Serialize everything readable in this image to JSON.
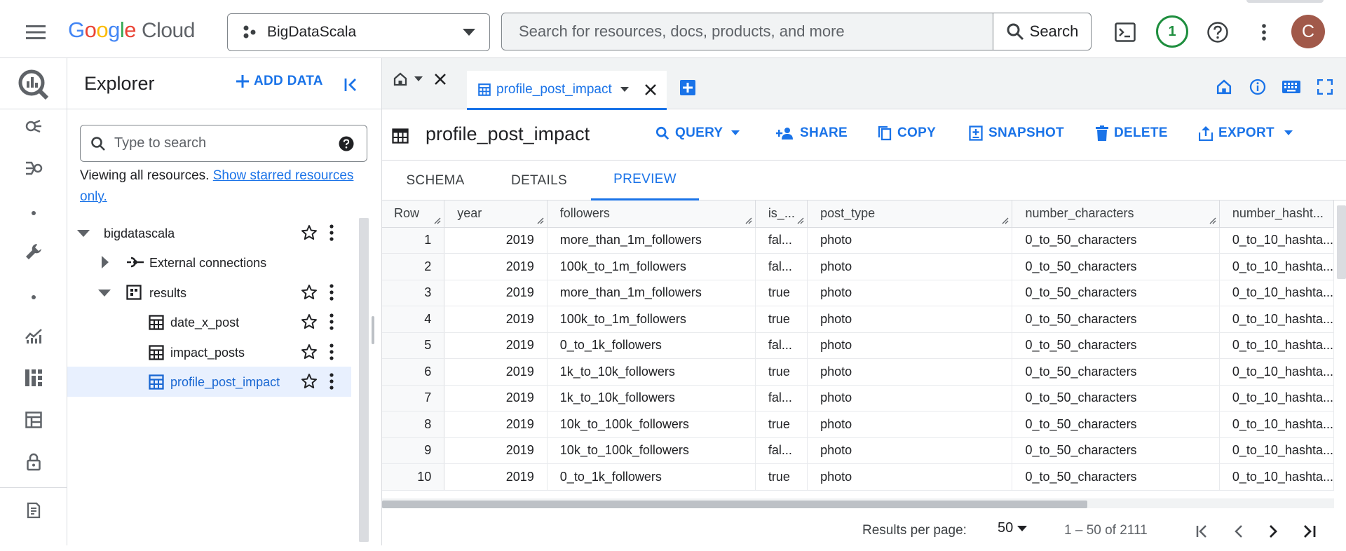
{
  "header": {
    "logo_letters": [
      "G",
      "o",
      "o",
      "g",
      "l",
      "e"
    ],
    "logo_colors": [
      "#4285F4",
      "#EA4335",
      "#FBBC05",
      "#4285F4",
      "#34A853",
      "#EA4335"
    ],
    "logo_cloud": "Cloud",
    "project": "BigDataScala",
    "search_placeholder": "Search for resources, docs, products, and more",
    "search_button": "Search",
    "notification_count": "1",
    "avatar_initial": "C"
  },
  "explorer": {
    "title": "Explorer",
    "add_data": "ADD DATA",
    "search_placeholder": "Type to search",
    "viewing_text": "Viewing all resources. ",
    "viewing_link": "Show starred resources only.",
    "tree": {
      "project": "bigdatascala",
      "external": "External connections",
      "dataset": "results",
      "tables": [
        "date_x_post",
        "impact_posts",
        "profile_post_impact"
      ]
    }
  },
  "tabs": {
    "active_tab": "profile_post_impact"
  },
  "table_header": {
    "title": "profile_post_impact",
    "actions": {
      "query": "QUERY",
      "share": "SHARE",
      "copy": "COPY",
      "snapshot": "SNAPSHOT",
      "delete": "DELETE",
      "export": "EXPORT"
    }
  },
  "subtabs": {
    "schema": "SCHEMA",
    "details": "DETAILS",
    "preview": "PREVIEW",
    "active": "PREVIEW"
  },
  "grid": {
    "columns": [
      "Row",
      "year",
      "followers",
      "is_...",
      "post_type",
      "number_characters",
      "number_hasht..."
    ],
    "rows": [
      [
        "1",
        "2019",
        "more_than_1m_followers",
        "fal...",
        "photo",
        "0_to_50_characters",
        "0_to_10_hashta..."
      ],
      [
        "2",
        "2019",
        "100k_to_1m_followers",
        "fal...",
        "photo",
        "0_to_50_characters",
        "0_to_10_hashta..."
      ],
      [
        "3",
        "2019",
        "more_than_1m_followers",
        "true",
        "photo",
        "0_to_50_characters",
        "0_to_10_hashta..."
      ],
      [
        "4",
        "2019",
        "100k_to_1m_followers",
        "true",
        "photo",
        "0_to_50_characters",
        "0_to_10_hashta..."
      ],
      [
        "5",
        "2019",
        "0_to_1k_followers",
        "fal...",
        "photo",
        "0_to_50_characters",
        "0_to_10_hashta..."
      ],
      [
        "6",
        "2019",
        "1k_to_10k_followers",
        "true",
        "photo",
        "0_to_50_characters",
        "0_to_10_hashta..."
      ],
      [
        "7",
        "2019",
        "1k_to_10k_followers",
        "fal...",
        "photo",
        "0_to_50_characters",
        "0_to_10_hashta..."
      ],
      [
        "8",
        "2019",
        "10k_to_100k_followers",
        "true",
        "photo",
        "0_to_50_characters",
        "0_to_10_hashta..."
      ],
      [
        "9",
        "2019",
        "10k_to_100k_followers",
        "fal...",
        "photo",
        "0_to_50_characters",
        "0_to_10_hashta..."
      ],
      [
        "10",
        "2019",
        "0_to_1k_followers",
        "true",
        "photo",
        "0_to_50_characters",
        "0_to_10_hashta..."
      ]
    ]
  },
  "pager": {
    "results_per_page_label": "Results per page:",
    "results_per_page": "50",
    "range": "1 – 50 of 2111"
  },
  "colors": {
    "accent": "#1a73e8",
    "selected_row_bg": "#e8f0fe",
    "notification": "#1e8e3e",
    "avatar": "#a1594a"
  },
  "icons": [
    "menu-icon",
    "project-icon",
    "search-icon",
    "terminal-icon",
    "help-icon",
    "more-vert-icon",
    "bigquery-icon",
    "analytics-icon",
    "pipeline-icon",
    "wrench-icon",
    "chart-icon",
    "dashboard-icon",
    "table-icon",
    "lock-icon",
    "notes-icon",
    "add-icon",
    "collapse-left-icon",
    "star-icon",
    "external-connection-icon",
    "dataset-icon",
    "home-icon",
    "close-icon",
    "add-tab-icon",
    "info-icon",
    "keyboard-icon",
    "fullscreen-icon",
    "share-icon",
    "copy-icon",
    "snapshot-icon",
    "delete-icon",
    "export-icon",
    "first-page-icon",
    "prev-page-icon",
    "next-page-icon",
    "last-page-icon"
  ]
}
